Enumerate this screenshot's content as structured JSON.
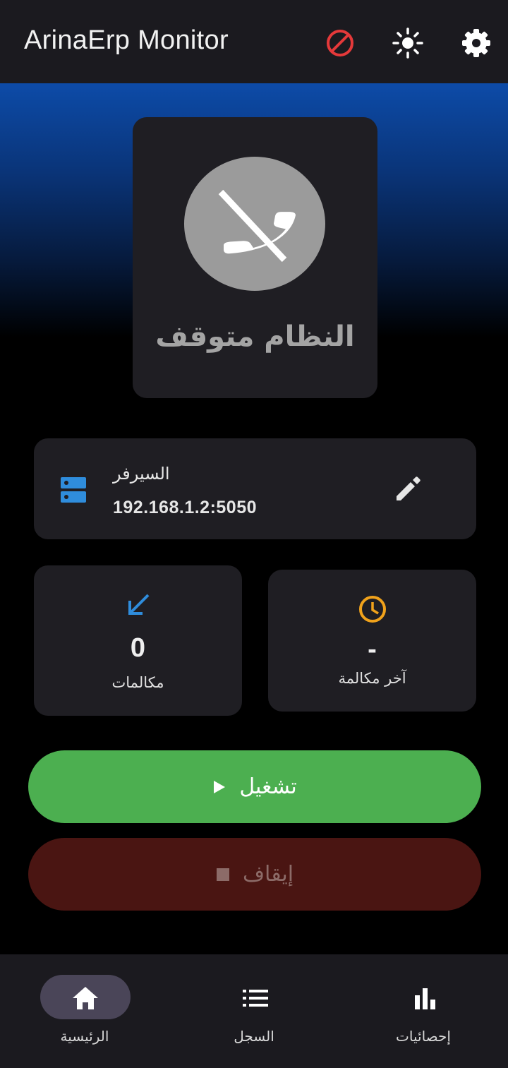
{
  "appbar": {
    "title": "ArinaErp Monitor",
    "icons": [
      "block-icon",
      "brightness-icon",
      "settings-icon"
    ],
    "block_color": "#e5393a"
  },
  "status": {
    "icon": "phone-disabled-icon",
    "text": "النظام متوقف"
  },
  "server": {
    "icon": "server-icon",
    "label": "السيرفر",
    "address": "192.168.1.2:5050",
    "edit_icon": "pencil-icon",
    "accent": "#2f8ddc"
  },
  "stats": {
    "calls": {
      "icon": "call-received-icon",
      "value": "0",
      "label": "مكالمات",
      "color": "#2f8ddc"
    },
    "last_call": {
      "icon": "clock-icon",
      "value": "-",
      "label": "آخر مكالمة",
      "color": "#f0a21b"
    }
  },
  "buttons": {
    "start": {
      "label": "تشغيل",
      "icon": "play-icon",
      "color": "#4caf50"
    },
    "stop": {
      "label": "إيقاف",
      "icon": "stop-icon",
      "color": "#4a1512"
    }
  },
  "nav": {
    "items": [
      {
        "label": "الرئيسية",
        "icon": "home-icon",
        "active": true
      },
      {
        "label": "السجل",
        "icon": "list-icon",
        "active": false
      },
      {
        "label": "إحصائيات",
        "icon": "bar-chart-icon",
        "active": false
      }
    ]
  }
}
